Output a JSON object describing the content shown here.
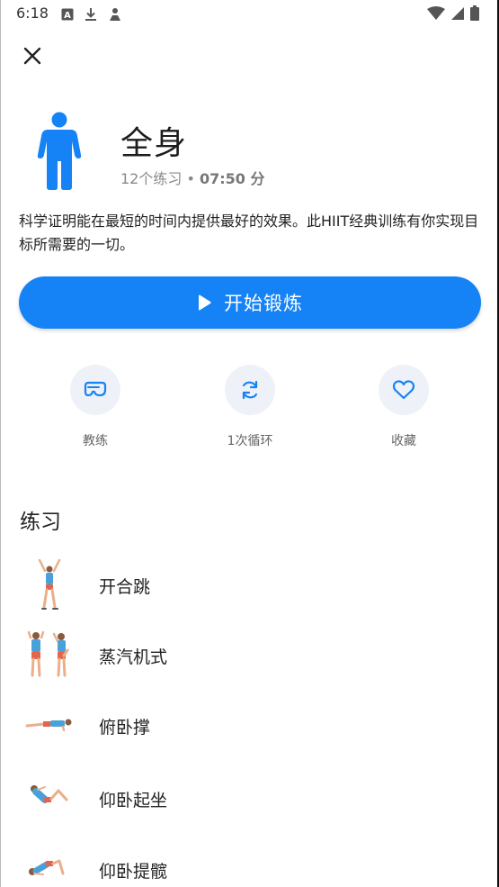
{
  "status_bar": {
    "time": "6:18",
    "left_icons": [
      "font-a-icon",
      "download-icon",
      "person-icon"
    ],
    "right_icons": [
      "wifi-icon",
      "signal-icon",
      "battery-icon"
    ]
  },
  "header": {
    "close_icon": "close-icon"
  },
  "workout": {
    "title": "全身",
    "count_text": "12个练习 • ",
    "duration_text": "07:50 分",
    "description": "科学证明能在最短的时间内提供最好的效果。此HIIT经典训练有你实现目标所需要的一切。",
    "figure_icon": "full-body-figure-icon",
    "accent_color": "#1583f6"
  },
  "start_button": {
    "label": "开始锻炼",
    "icon": "play-icon"
  },
  "actions": [
    {
      "label": "教练",
      "icon": "coach-icon"
    },
    {
      "label": "1次循环",
      "icon": "repeat-icon"
    },
    {
      "label": "收藏",
      "icon": "heart-icon"
    }
  ],
  "exercises_section": {
    "title": "练习",
    "items": [
      {
        "name": "开合跳",
        "icon": "jumping-jacks-icon"
      },
      {
        "name": "蒸汽机式",
        "icon": "steam-engine-icon"
      },
      {
        "name": "俯卧撑",
        "icon": "push-up-icon"
      },
      {
        "name": "仰卧起坐",
        "icon": "sit-up-icon"
      },
      {
        "name": "仰卧提髋",
        "icon": "glute-bridge-icon"
      }
    ]
  }
}
